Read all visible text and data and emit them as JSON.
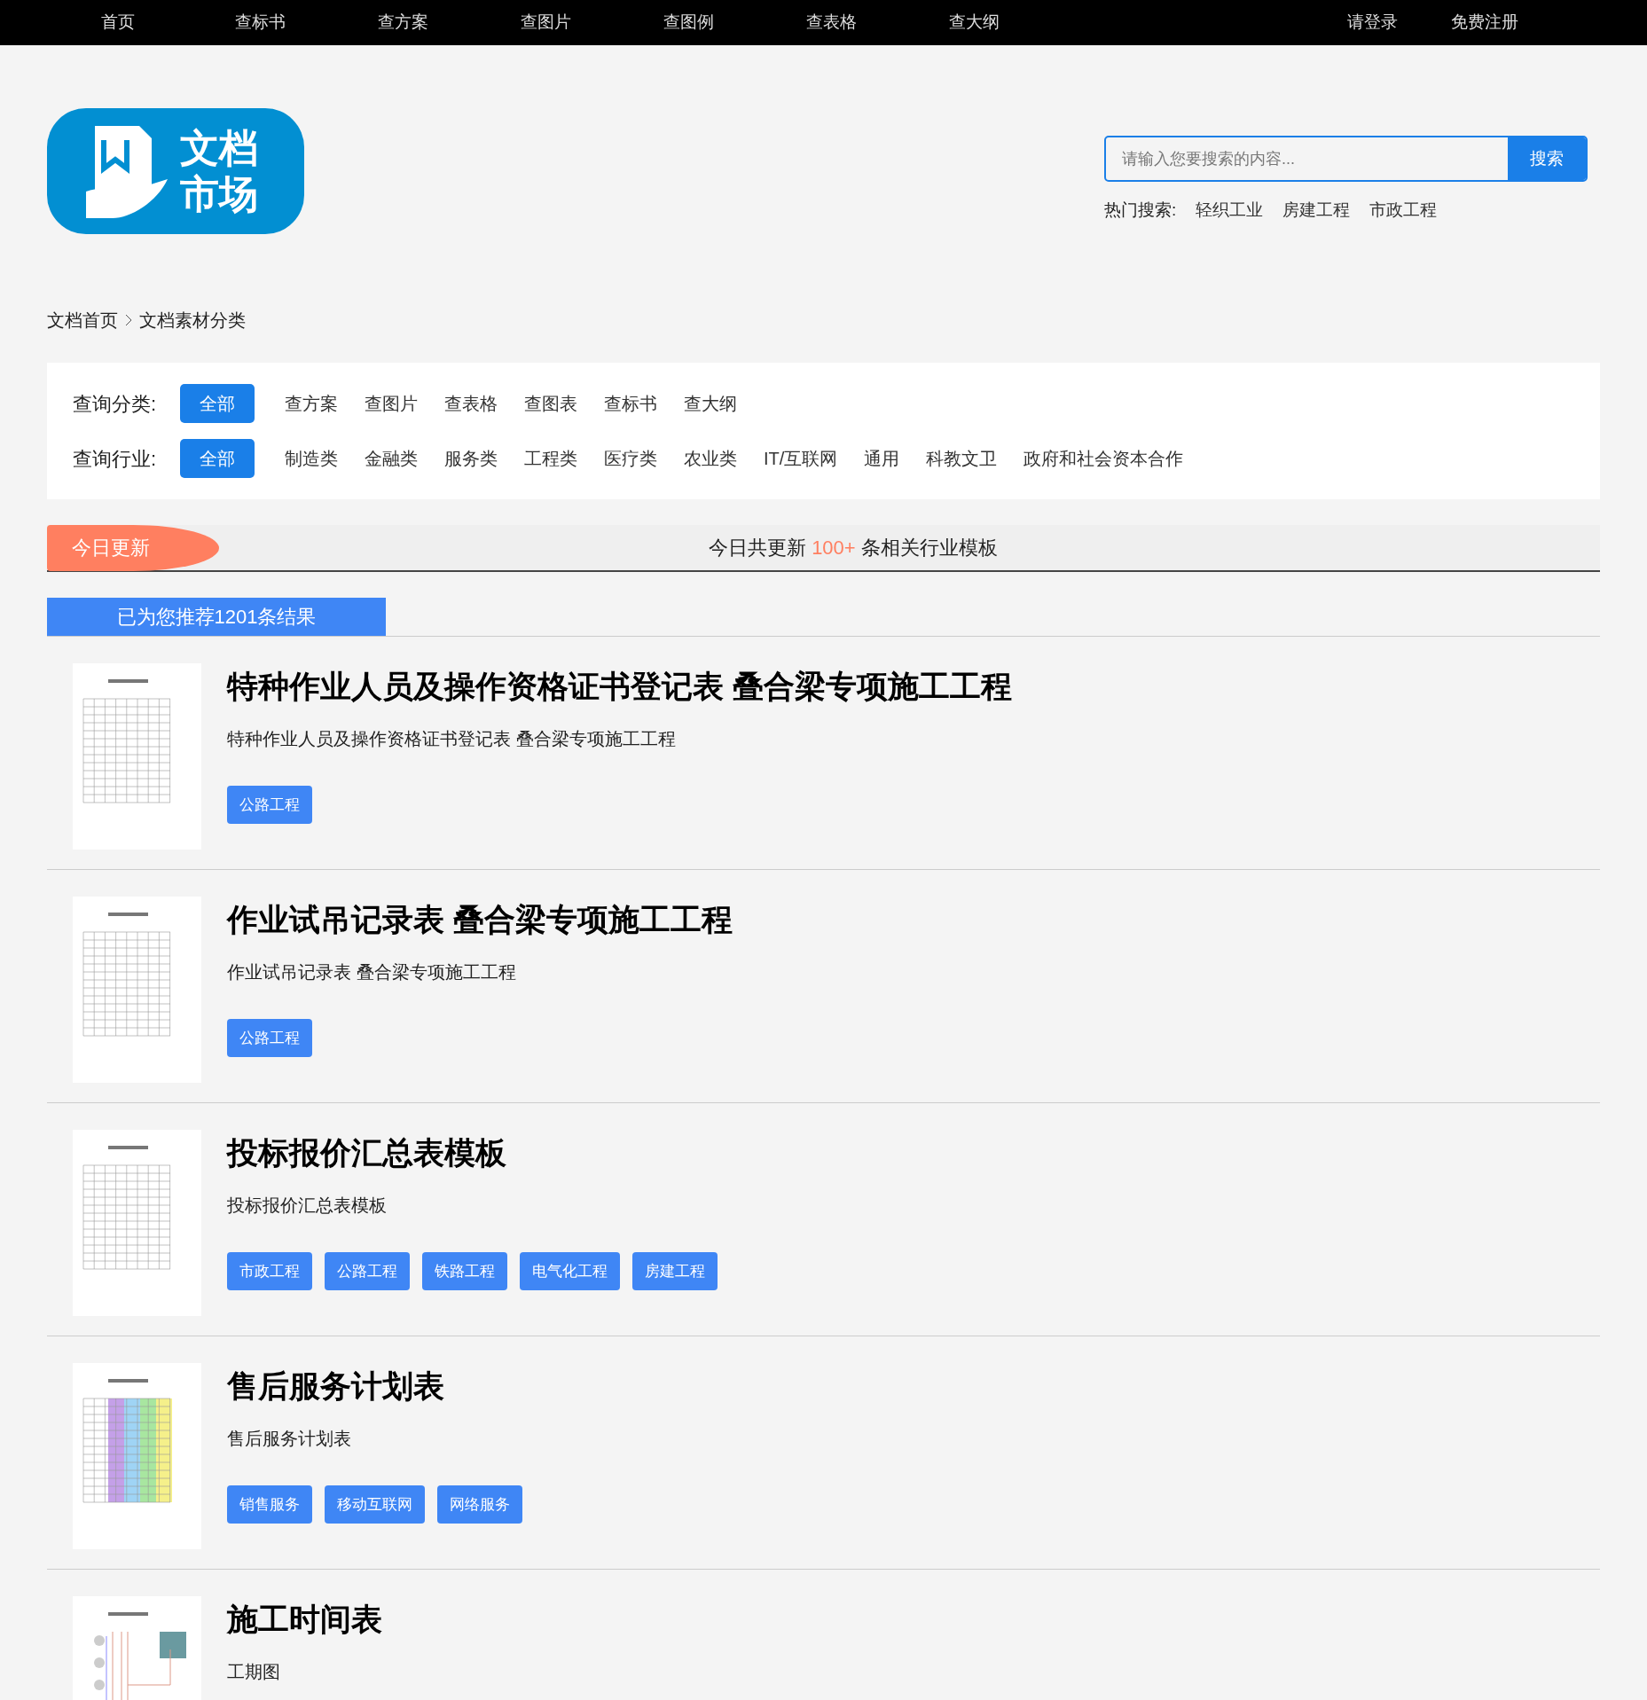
{
  "nav": {
    "items": [
      {
        "label": "首页"
      },
      {
        "label": "查标书"
      },
      {
        "label": "查方案"
      },
      {
        "label": "查图片"
      },
      {
        "label": "查图例"
      },
      {
        "label": "查表格"
      },
      {
        "label": "查大纲"
      }
    ],
    "account": [
      {
        "label": "请登录"
      },
      {
        "label": "免费注册"
      }
    ]
  },
  "logo": {
    "line1": "文档",
    "line2": "市场"
  },
  "search": {
    "placeholder": "请输入您要搜索的内容...",
    "button": "搜索",
    "hot_label": "热门搜索:",
    "hot": [
      "轻织工业",
      "房建工程",
      "市政工程"
    ]
  },
  "breadcrumb": {
    "items": [
      "文档首页",
      "文档素材分类"
    ]
  },
  "filters": [
    {
      "label": "查询分类:",
      "options": [
        {
          "label": "全部",
          "selected": true
        },
        {
          "label": "查方案",
          "selected": false
        },
        {
          "label": "查图片",
          "selected": false
        },
        {
          "label": "查表格",
          "selected": false
        },
        {
          "label": "查图表",
          "selected": false
        },
        {
          "label": "查标书",
          "selected": false
        },
        {
          "label": "查大纲",
          "selected": false
        }
      ]
    },
    {
      "label": "查询行业:",
      "options": [
        {
          "label": "全部",
          "selected": true
        },
        {
          "label": "制造类",
          "selected": false
        },
        {
          "label": "金融类",
          "selected": false
        },
        {
          "label": "服务类",
          "selected": false
        },
        {
          "label": "工程类",
          "selected": false
        },
        {
          "label": "医疗类",
          "selected": false
        },
        {
          "label": "农业类",
          "selected": false
        },
        {
          "label": "IT/互联网",
          "selected": false
        },
        {
          "label": "通用",
          "selected": false
        },
        {
          "label": "科教文卫",
          "selected": false
        },
        {
          "label": "政府和社会资本合作",
          "selected": false
        }
      ]
    }
  ],
  "today": {
    "badge": "今日更新",
    "before": "今日共更新",
    "count": "100+",
    "after": "条相关行业模板"
  },
  "results": {
    "header": "已为您推荐1201条结果",
    "items": [
      {
        "kind": "table",
        "title": "特种作业人员及操作资格证书登记表 叠合梁专项施工工程",
        "description": "特种作业人员及操作资格证书登记表 叠合梁专项施工工程",
        "tags": [
          "公路工程"
        ]
      },
      {
        "kind": "table",
        "title": "作业试吊记录表 叠合梁专项施工工程",
        "description": "作业试吊记录表 叠合梁专项施工工程",
        "tags": [
          "公路工程"
        ]
      },
      {
        "kind": "table",
        "title": "投标报价汇总表模板",
        "description": "投标报价汇总表模板",
        "tags": [
          "市政工程",
          "公路工程",
          "铁路工程",
          "电气化工程",
          "房建工程"
        ]
      },
      {
        "kind": "colored",
        "title": "售后服务计划表",
        "description": "售后服务计划表",
        "tags": [
          "销售服务",
          "移动互联网",
          "网络服务"
        ]
      },
      {
        "kind": "diagram",
        "title": "施工时间表",
        "description": "工期图"
      }
    ]
  }
}
